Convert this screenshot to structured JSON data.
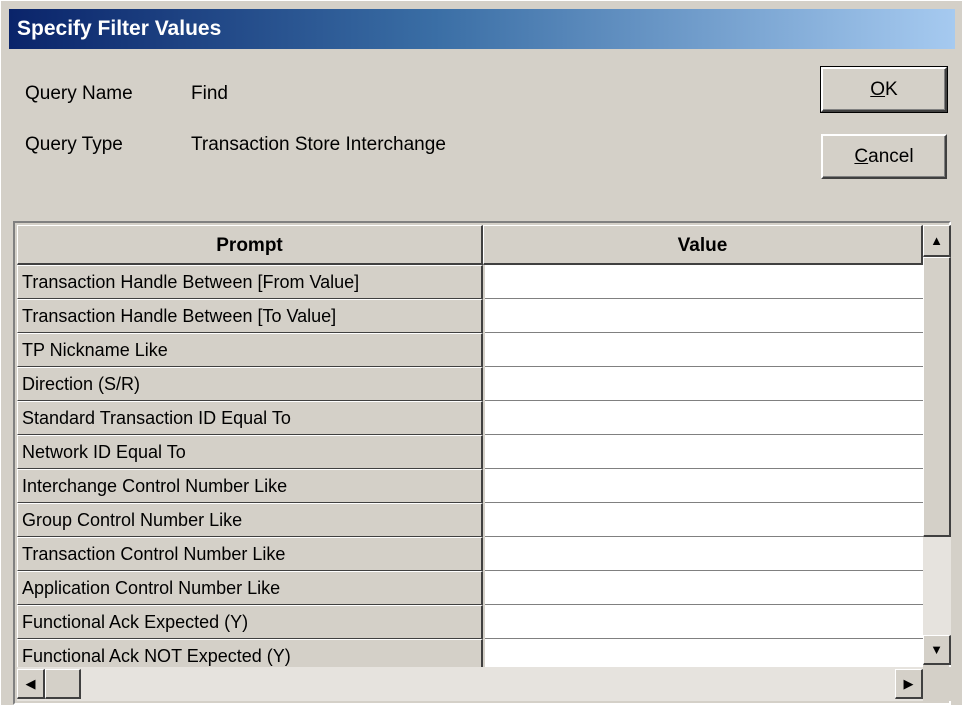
{
  "window": {
    "title": "Specify Filter Values"
  },
  "query": {
    "name_label": "Query Name",
    "name_value": "Find",
    "type_label": "Query Type",
    "type_value": "Transaction Store Interchange"
  },
  "buttons": {
    "ok_mnemonic": "O",
    "ok_rest": "K",
    "cancel_mnemonic": "C",
    "cancel_rest": "ancel"
  },
  "grid": {
    "columns": [
      "Prompt",
      "Value"
    ],
    "rows": [
      {
        "prompt": "Transaction Handle Between [From Value]",
        "value": ""
      },
      {
        "prompt": "Transaction Handle Between [To Value]",
        "value": ""
      },
      {
        "prompt": "TP Nickname Like",
        "value": ""
      },
      {
        "prompt": "Direction (S/R)",
        "value": ""
      },
      {
        "prompt": "Standard Transaction ID Equal To",
        "value": ""
      },
      {
        "prompt": "Network ID Equal To",
        "value": ""
      },
      {
        "prompt": "Interchange Control Number Like",
        "value": ""
      },
      {
        "prompt": "Group Control Number Like",
        "value": ""
      },
      {
        "prompt": "Transaction Control Number Like",
        "value": ""
      },
      {
        "prompt": "Application Control Number Like",
        "value": ""
      },
      {
        "prompt": "Functional Ack Expected (Y)",
        "value": ""
      },
      {
        "prompt": "Functional Ack NOT Expected (Y)",
        "value": ""
      }
    ]
  },
  "icons": {
    "scroll_up": "▲",
    "scroll_down": "▼",
    "scroll_left": "◀",
    "scroll_right": "▶"
  }
}
